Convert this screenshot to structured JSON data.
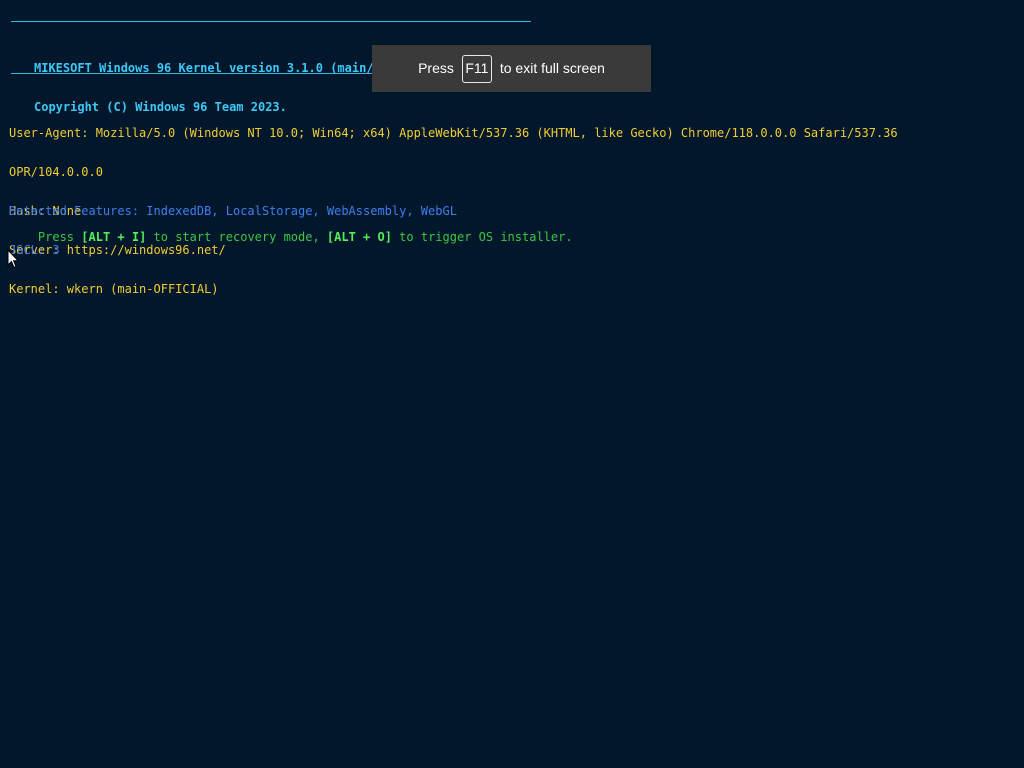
{
  "banner": {
    "line1": "MIKESOFT Windows 96 Kernel version 3.1.0 (main/web)",
    "line2": "Copyright (C) Windows 96 Team 2023."
  },
  "info": {
    "user_agent_line1": "User-Agent: Mozilla/5.0 (Windows NT 10.0; Win64; x64) AppleWebKit/537.36 (KHTML, like Gecko) Chrome/118.0.0.0 Safari/537.36",
    "user_agent_line2": "OPR/104.0.0.0",
    "hash": "Hash: None",
    "server": "Server: https://windows96.net/",
    "kernel": "Kernel: wkern (main-OFFICIAL)"
  },
  "features": {
    "detected": "Detected Features: IndexedDB, LocalStorage, WebAssembly, WebGL",
    "jscl": "JSCL: 3"
  },
  "prompt": {
    "prefix": "Press ",
    "key_recovery": "[ALT + I]",
    "middle": " to start recovery mode, ",
    "key_installer": "[ALT + O]",
    "suffix": " to trigger OS installer."
  },
  "fullscreen_toast": {
    "press": "Press",
    "key": "F11",
    "message": "to exit full screen"
  },
  "colors": {
    "background": "#01172c",
    "banner": "#3cc8f5",
    "info": "#f1cd33",
    "features": "#3e7ef0",
    "prompt": "#3cc743"
  },
  "icons": {
    "cursor": "mouse-pointer-icon"
  }
}
